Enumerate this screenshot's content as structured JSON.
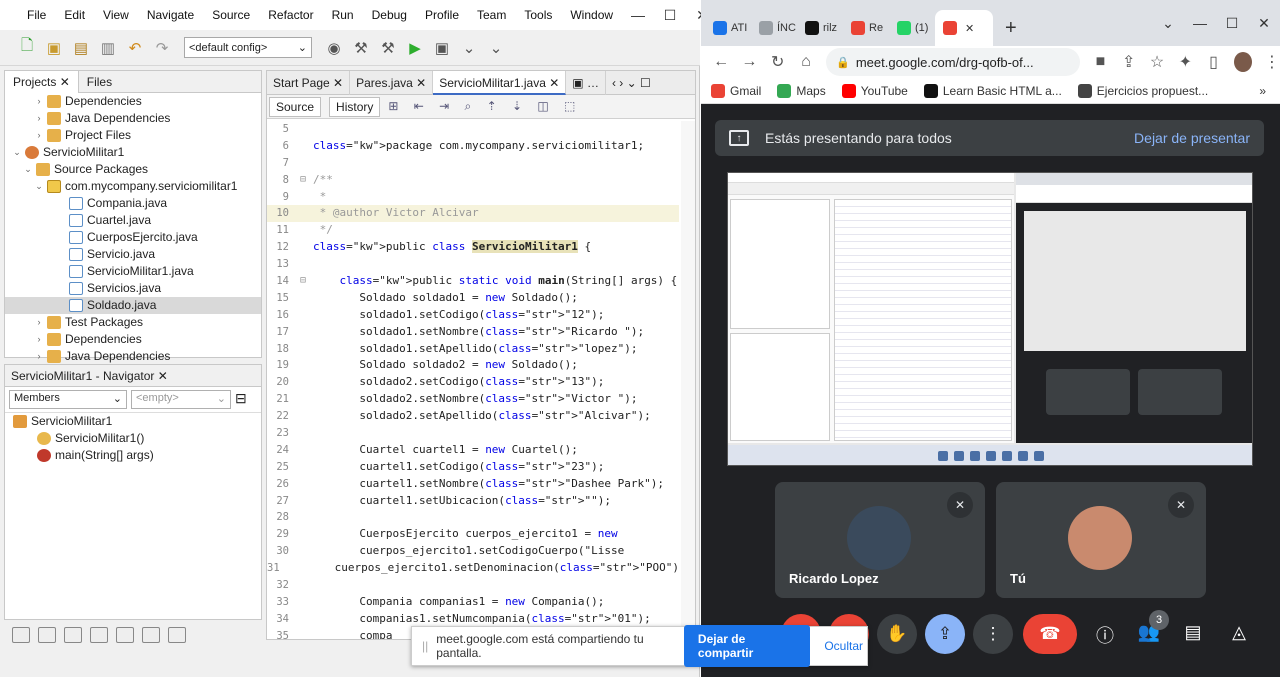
{
  "netbeans": {
    "menus": [
      "File",
      "Edit",
      "View",
      "Navigate",
      "Source",
      "Refactor",
      "Run",
      "Debug",
      "Profile",
      "Team",
      "Tools",
      "Window"
    ],
    "config": "<default config>",
    "projects_tab": "Projects",
    "files_tab": "Files",
    "tree": [
      {
        "label": "Dependencies",
        "indent": 2,
        "icon": "folder",
        "twisty": "›"
      },
      {
        "label": "Java Dependencies",
        "indent": 2,
        "icon": "folder",
        "twisty": "›"
      },
      {
        "label": "Project Files",
        "indent": 2,
        "icon": "folder",
        "twisty": "›"
      },
      {
        "label": "ServicioMilitar1",
        "indent": 0,
        "icon": "proj",
        "twisty": "⌄"
      },
      {
        "label": "Source Packages",
        "indent": 1,
        "icon": "folder",
        "twisty": "⌄"
      },
      {
        "label": "com.mycompany.serviciomilitar1",
        "indent": 2,
        "icon": "pkg",
        "twisty": "⌄"
      },
      {
        "label": "Compania.java",
        "indent": 4,
        "icon": "file",
        "twisty": ""
      },
      {
        "label": "Cuartel.java",
        "indent": 4,
        "icon": "file",
        "twisty": ""
      },
      {
        "label": "CuerposEjercito.java",
        "indent": 4,
        "icon": "file",
        "twisty": ""
      },
      {
        "label": "Servicio.java",
        "indent": 4,
        "icon": "file",
        "twisty": ""
      },
      {
        "label": "ServicioMilitar1.java",
        "indent": 4,
        "icon": "file",
        "twisty": ""
      },
      {
        "label": "Servicios.java",
        "indent": 4,
        "icon": "file",
        "twisty": ""
      },
      {
        "label": "Soldado.java",
        "indent": 4,
        "icon": "file",
        "twisty": "",
        "selected": true
      },
      {
        "label": "Test Packages",
        "indent": 2,
        "icon": "folder",
        "twisty": "›"
      },
      {
        "label": "Dependencies",
        "indent": 2,
        "icon": "folder",
        "twisty": "›"
      },
      {
        "label": "Java Dependencies",
        "indent": 2,
        "icon": "folder",
        "twisty": "›"
      }
    ],
    "navigator_title": "ServicioMilitar1 - Navigator",
    "members_select": "Members",
    "empty_select": "<empty>",
    "navigator_items": [
      {
        "label": "ServicioMilitar1",
        "indent": 0
      },
      {
        "label": "ServicioMilitar1()",
        "indent": 2
      },
      {
        "label": "main(String[] args)",
        "indent": 2
      }
    ],
    "editor_tabs": [
      "Start Page",
      "Pares.java",
      "ServicioMilitar1.java"
    ],
    "source_btn": "Source",
    "history_btn": "History",
    "code_lines": [
      {
        "n": "5",
        "t": ""
      },
      {
        "n": "6",
        "t": "package com.mycompany.serviciomilitar1;",
        "cls": "kwline"
      },
      {
        "n": "7",
        "t": ""
      },
      {
        "n": "8",
        "t": "/**",
        "c": true,
        "fold": "−"
      },
      {
        "n": "9",
        "t": " *",
        "c": true
      },
      {
        "n": "10",
        "t": " * @author Victor Alcivar",
        "c": true,
        "hl": true
      },
      {
        "n": "11",
        "t": " */",
        "c": true
      },
      {
        "n": "12",
        "t": "public class ServicioMilitar1 {",
        "decl": true
      },
      {
        "n": "13",
        "t": ""
      },
      {
        "n": "14",
        "t": "    public static void main(String[] args) {",
        "fold": "−",
        "main": true
      },
      {
        "n": "15",
        "t": "       Soldado soldado1 = new Soldado();"
      },
      {
        "n": "16",
        "t": "       soldado1.setCodigo(\"12\");"
      },
      {
        "n": "17",
        "t": "       soldado1.setNombre(\"Ricardo \");"
      },
      {
        "n": "18",
        "t": "       soldado1.setApellido(\"lopez\");"
      },
      {
        "n": "19",
        "t": "       Soldado soldado2 = new Soldado();"
      },
      {
        "n": "20",
        "t": "       soldado2.setCodigo(\"13\");"
      },
      {
        "n": "21",
        "t": "       soldado2.setNombre(\"Victor \");"
      },
      {
        "n": "22",
        "t": "       soldado2.setApellido(\"Alcivar\");"
      },
      {
        "n": "23",
        "t": ""
      },
      {
        "n": "24",
        "t": "       Cuartel cuartel1 = new Cuartel();"
      },
      {
        "n": "25",
        "t": "       cuartel1.setCodigo(\"23\");"
      },
      {
        "n": "26",
        "t": "       cuartel1.setNombre(\"Dashee Park\");"
      },
      {
        "n": "27",
        "t": "       cuartel1.setUbicacion(\"\");"
      },
      {
        "n": "28",
        "t": ""
      },
      {
        "n": "29",
        "t": "       CuerposEjercito cuerpos_ejercito1 = new"
      },
      {
        "n": "30",
        "t": "       cuerpos_ejercito1.setCodigoCuerpo(\"Lisse"
      },
      {
        "n": "31",
        "t": "       cuerpos_ejercito1.setDenominacion(\"POO\")"
      },
      {
        "n": "32",
        "t": ""
      },
      {
        "n": "33",
        "t": "       Compania companias1 = new Compania();"
      },
      {
        "n": "34",
        "t": "       companias1.setNumcompania(\"01\");"
      },
      {
        "n": "35",
        "t": "       compa"
      }
    ]
  },
  "chrome": {
    "tabs": [
      {
        "label": "ATI",
        "color": "#1a73e8"
      },
      {
        "label": "ÍNC",
        "color": "#9aa0a6"
      },
      {
        "label": "rilz",
        "color": "#111"
      },
      {
        "label": "Re",
        "color": "#ea4335"
      },
      {
        "label": "(1)",
        "color": "#25d366"
      },
      {
        "label": "",
        "color": "#ea4335",
        "active": true
      }
    ],
    "url": "meet.google.com/drg-qofb-of...",
    "bookmarks": [
      {
        "label": "Gmail",
        "color": "#ea4335"
      },
      {
        "label": "Maps",
        "color": "#34a853"
      },
      {
        "label": "YouTube",
        "color": "#ff0000"
      },
      {
        "label": "Learn Basic HTML a...",
        "color": "#111"
      },
      {
        "label": "Ejercicios propuest...",
        "color": "#444"
      }
    ]
  },
  "meet": {
    "banner_text": "Estás presentando para todos",
    "stop_presenting": "Dejar de presentar",
    "participants": [
      {
        "name": "Ricardo Lopez",
        "avatar_color": "#3a4a5c"
      },
      {
        "name": "Tú",
        "avatar_color": "#c98a6e"
      }
    ],
    "people_count": "3"
  },
  "share_bar": {
    "text": "meet.google.com está compartiendo tu pantalla.",
    "stop_label": "Dejar de compartir",
    "hide_label": "Ocultar"
  }
}
